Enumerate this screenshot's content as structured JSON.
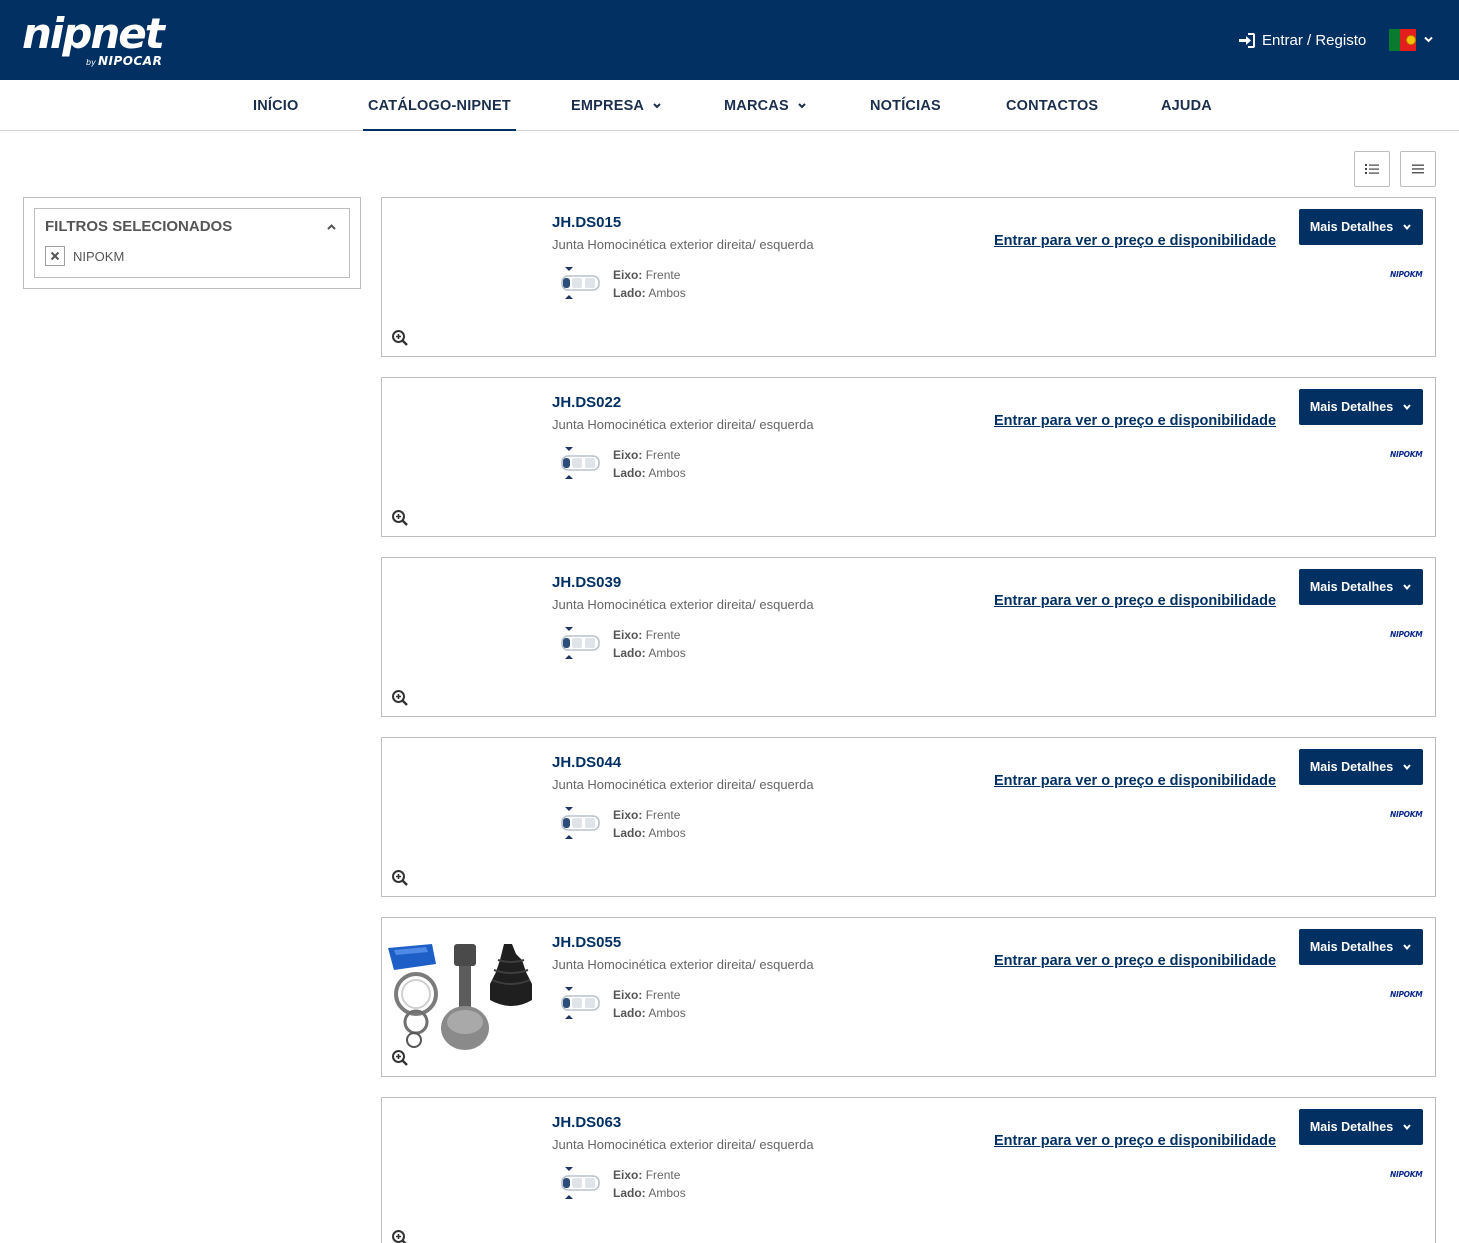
{
  "header": {
    "logo_main": "nipnet",
    "logo_by": "by",
    "logo_sub": "NIPOCAR",
    "login_label": "Entrar / Registo"
  },
  "nav": {
    "items": [
      {
        "label": "INÍCIO"
      },
      {
        "label": "CATÁLOGO-NIPNET"
      },
      {
        "label": "EMPRESA"
      },
      {
        "label": "MARCAS"
      },
      {
        "label": "NOTÍCIAS"
      },
      {
        "label": "CONTACTOS"
      },
      {
        "label": "AJUDA"
      }
    ]
  },
  "filters": {
    "title": "FILTROS SELECIONADOS",
    "selected": [
      "NIPOKM"
    ]
  },
  "products": [
    {
      "code": "JH.DS015",
      "description": "Junta Homocinética exterior direita/ esquerda",
      "eixo_label": "Eixo:",
      "eixo": "Frente",
      "lado_label": "Lado:",
      "lado": "Ambos",
      "price_link": "Entrar para ver o preço e disponibilidade",
      "details_label": "Mais Detalhes",
      "brand": "NIPOKM"
    },
    {
      "code": "JH.DS022",
      "description": "Junta Homocinética exterior direita/ esquerda",
      "eixo_label": "Eixo:",
      "eixo": "Frente",
      "lado_label": "Lado:",
      "lado": "Ambos",
      "price_link": "Entrar para ver o preço e disponibilidade",
      "details_label": "Mais Detalhes",
      "brand": "NIPOKM"
    },
    {
      "code": "JH.DS039",
      "description": "Junta Homocinética exterior direita/ esquerda",
      "eixo_label": "Eixo:",
      "eixo": "Frente",
      "lado_label": "Lado:",
      "lado": "Ambos",
      "price_link": "Entrar para ver o preço e disponibilidade",
      "details_label": "Mais Detalhes",
      "brand": "NIPOKM"
    },
    {
      "code": "JH.DS044",
      "description": "Junta Homocinética exterior direita/ esquerda",
      "eixo_label": "Eixo:",
      "eixo": "Frente",
      "lado_label": "Lado:",
      "lado": "Ambos",
      "price_link": "Entrar para ver o preço e disponibilidade",
      "details_label": "Mais Detalhes",
      "brand": "NIPOKM"
    },
    {
      "code": "JH.DS055",
      "description": "Junta Homocinética exterior direita/ esquerda",
      "eixo_label": "Eixo:",
      "eixo": "Frente",
      "lado_label": "Lado:",
      "lado": "Ambos",
      "price_link": "Entrar para ver o preço e disponibilidade",
      "details_label": "Mais Detalhes",
      "brand": "NIPOKM"
    },
    {
      "code": "JH.DS063",
      "description": "Junta Homocinética exterior direita/ esquerda",
      "eixo_label": "Eixo:",
      "eixo": "Frente",
      "lado_label": "Lado:",
      "lado": "Ambos",
      "price_link": "Entrar para ver o preço e disponibilidade",
      "details_label": "Mais Detalhes",
      "brand": "NIPOKM"
    }
  ],
  "icons": {
    "login": "sign-in-icon",
    "flag": "portugal-flag-icon",
    "list_view": "list-view-icon",
    "compact_view": "compact-list-icon",
    "zoom": "zoom-in-icon",
    "axle": "car-axle-icon"
  },
  "colors": {
    "primary": "#033062",
    "border": "#bdbdbd",
    "text_muted": "#666666"
  }
}
